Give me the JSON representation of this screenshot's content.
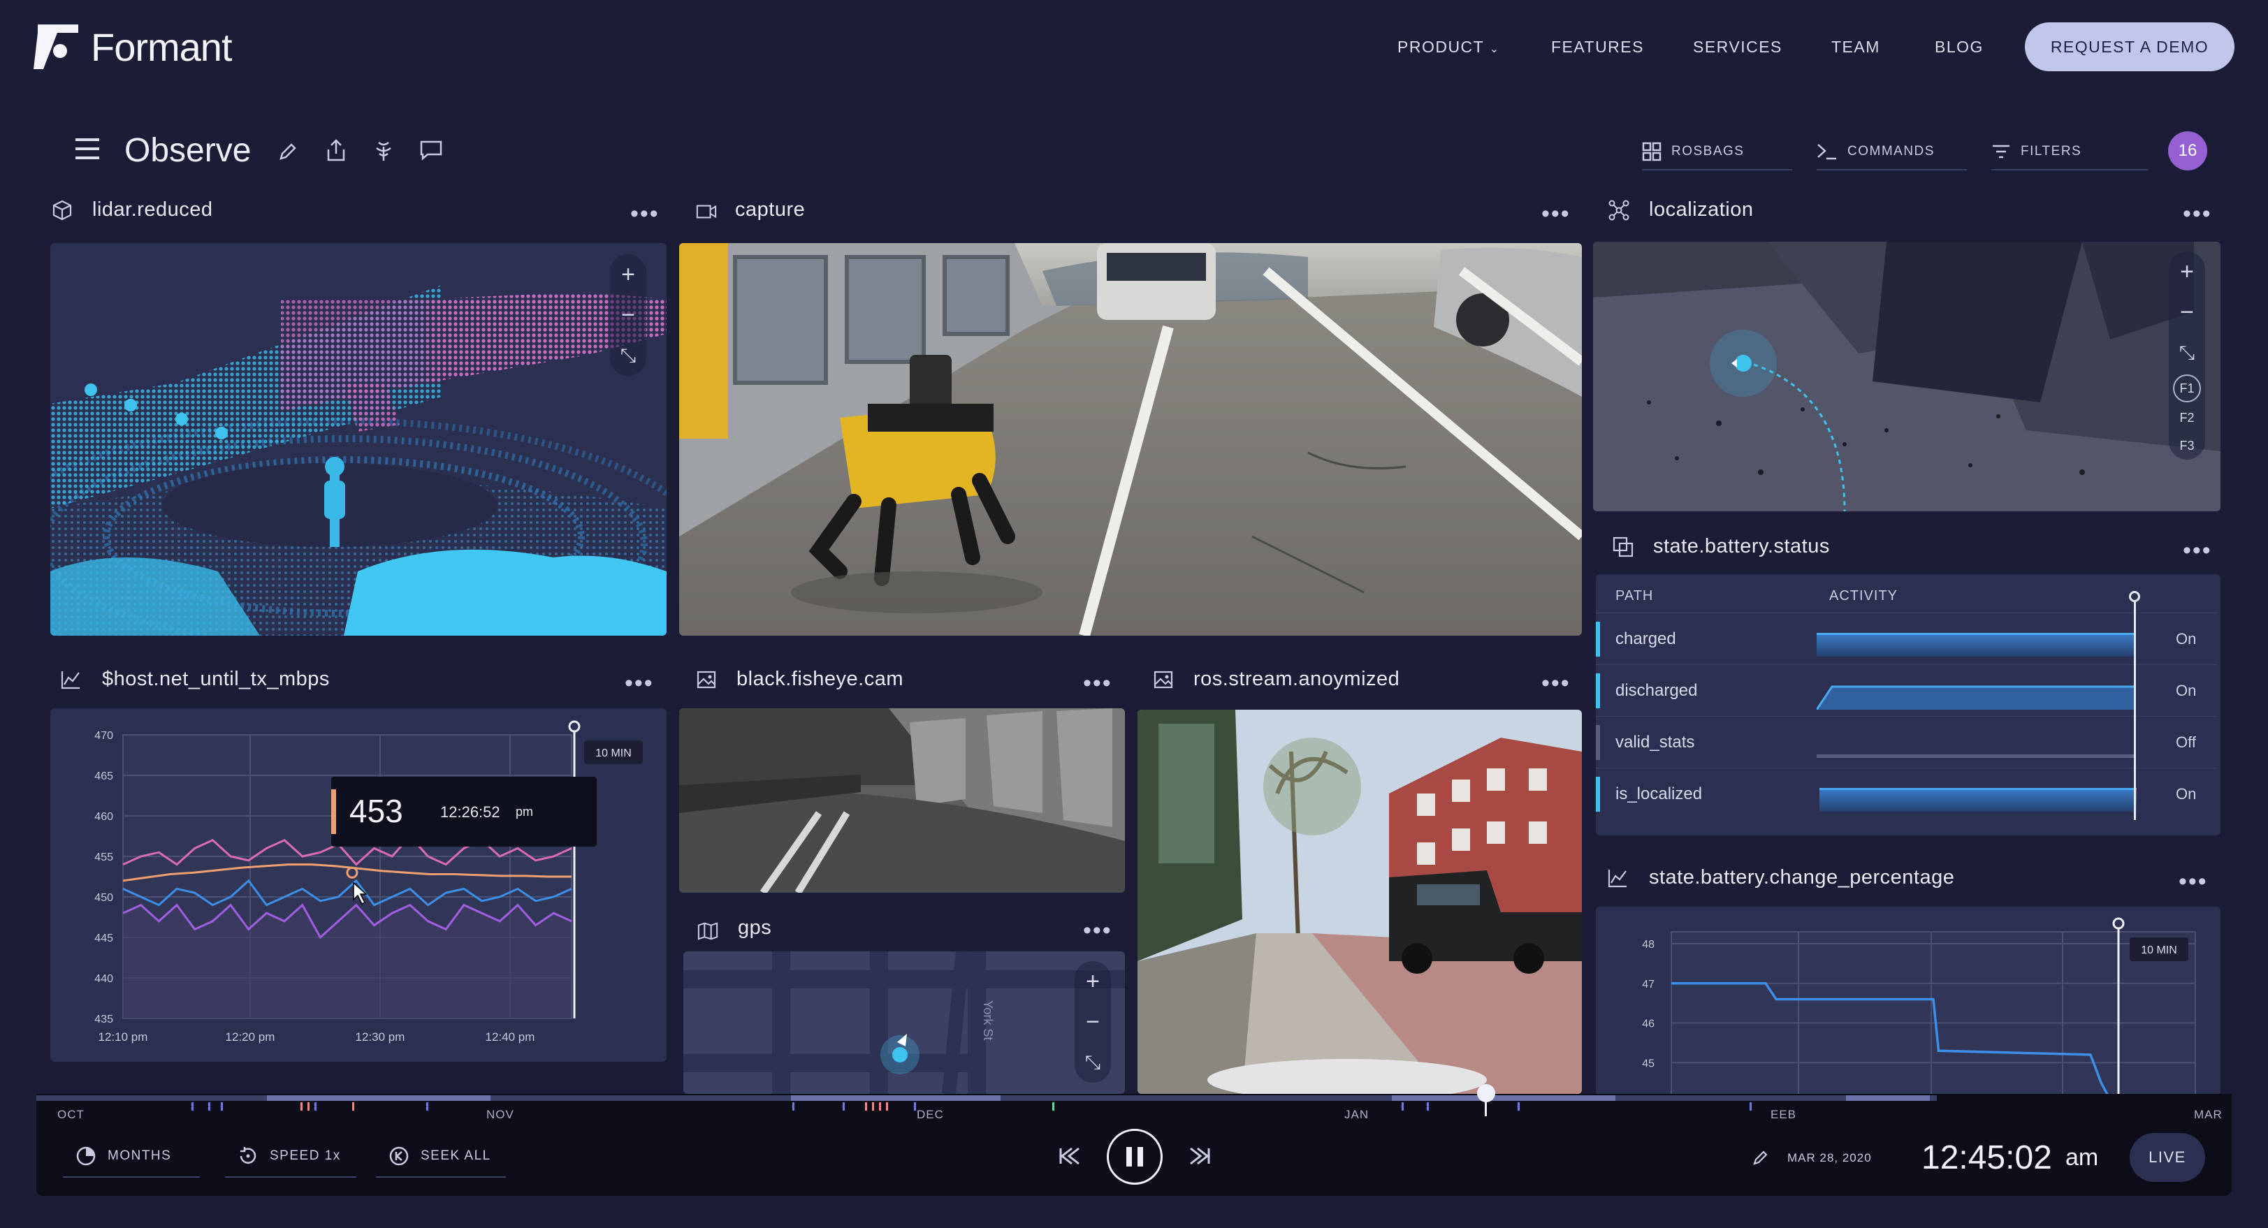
{
  "site": {
    "logo_text": "Formant",
    "nav": [
      "PRODUCT",
      "FEATURES",
      "SERVICES",
      "TEAM",
      "BLOG"
    ],
    "product_chevron": "⌄",
    "cta": "REQUEST A DEMO"
  },
  "toolbar": {
    "title": "Observe",
    "tabs": [
      "ROSBAGS",
      "COMMANDS",
      "FILTERS"
    ],
    "badge_count": "16"
  },
  "panels": {
    "lidar": {
      "title": "lidar.reduced"
    },
    "capture": {
      "title": "capture"
    },
    "localization": {
      "title": "localization",
      "floors": [
        "F1",
        "F2",
        "F3"
      ]
    },
    "net": {
      "title": "$host.net_until_tx_mbps"
    },
    "fisheye": {
      "title": "black.fisheye.cam"
    },
    "ros": {
      "title": "ros.stream.anoymized"
    },
    "gps": {
      "title": "gps",
      "street": "York St"
    },
    "battery_status": {
      "title": "state.battery.status",
      "col_path": "PATH",
      "col_activity": "ACTIVITY",
      "rows": [
        {
          "name": "charged",
          "state": "On",
          "active": true
        },
        {
          "name": "discharged",
          "state": "On",
          "active": true
        },
        {
          "name": "valid_stats",
          "state": "Off",
          "active": false
        },
        {
          "name": "is_localized",
          "state": "On",
          "active": true
        }
      ]
    },
    "battery_change": {
      "title": "state.battery.change_percentage"
    }
  },
  "colors": {
    "background": "#1b1d36",
    "panel": "#2c3050",
    "accent_blue": "#3b8fe8",
    "pink": "#d96bb5",
    "purple": "#9f5ee0",
    "orange": "#f0a070",
    "cyan": "#3fc3ee",
    "cta": "#c0c5ea",
    "badge": "#9460d2"
  },
  "chart_data": [
    {
      "type": "line",
      "title": "$host.net_until_tx_mbps",
      "x_ticks": [
        "12:10 pm",
        "12:20 pm",
        "12:30 pm",
        "12:40 pm"
      ],
      "y_ticks": [
        435,
        440,
        445,
        450,
        455,
        460,
        465,
        470
      ],
      "ylim": [
        435,
        470
      ],
      "window_label": "10 MIN",
      "tooltip": {
        "value": "453",
        "time": "12:26:52",
        "ampm": "pm"
      },
      "series": [
        {
          "color": "#d96bb5",
          "values": [
            454,
            455,
            455.5,
            454,
            456,
            457,
            455,
            454.5,
            456,
            457,
            455,
            455.5,
            456.5,
            454,
            456,
            455,
            457.5,
            455,
            454,
            456,
            457,
            455,
            456,
            454.5,
            455,
            456
          ]
        },
        {
          "color": "#f0a070",
          "values": [
            452,
            452.4,
            452.8,
            453,
            453.3,
            453.6,
            453.8,
            454,
            454,
            453.8,
            453.5,
            453.2,
            453,
            452.8,
            452.8,
            452.7,
            452.6,
            452.6,
            452.5,
            452.5
          ]
        },
        {
          "color": "#3b8fe8",
          "values": [
            451,
            450,
            449,
            451,
            450.5,
            449,
            450,
            452,
            449,
            450,
            451,
            449.5,
            450,
            452,
            449,
            450,
            451,
            449,
            450.5,
            451,
            449.5,
            450,
            451,
            449.5,
            450,
            451
          ]
        },
        {
          "color": "#9f5ee0",
          "values": [
            448,
            449,
            447,
            449,
            446,
            447,
            449,
            446,
            448,
            447,
            449,
            445,
            447,
            449,
            446.5,
            448,
            449,
            447,
            446,
            449,
            448,
            447,
            449,
            446.5,
            448,
            447
          ]
        }
      ]
    },
    {
      "type": "line",
      "title": "state.battery.change_percentage",
      "y_ticks": [
        45,
        46,
        47,
        48
      ],
      "ylim": [
        44,
        48.3
      ],
      "window_label": "10 MIN",
      "series": [
        {
          "color": "#3b8fe8",
          "points": [
            [
              0,
              47
            ],
            [
              0.18,
              47
            ],
            [
              0.2,
              46.6
            ],
            [
              0.5,
              46.6
            ],
            [
              0.51,
              45.3
            ],
            [
              0.8,
              45.2
            ],
            [
              0.82,
              44.5
            ],
            [
              0.84,
              44
            ]
          ]
        }
      ]
    }
  ],
  "timeline": {
    "months": [
      "OCT",
      "NOV",
      "DEC",
      "JAN",
      "EEB",
      "MAR"
    ],
    "controls": [
      "MONTHS",
      "SPEED 1x",
      "SEEK ALL"
    ],
    "date": "MAR 28, 2020",
    "time": "12:45:02",
    "ampm": "am",
    "live": "LIVE"
  }
}
